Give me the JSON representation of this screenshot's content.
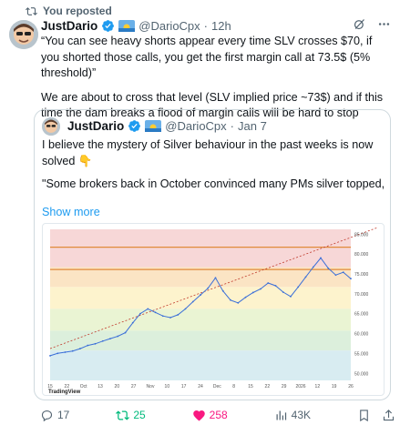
{
  "repost": {
    "label": "You reposted"
  },
  "tweet": {
    "author_name": "JustDario",
    "handle": "@DarioCpx",
    "dot": "·",
    "time": "12h",
    "paragraphs": [
      "“You can see heavy shorts appear every time SLV crosses $70, if you shorted those calls, you get the first margin call at 73.5$ (5% threshold)”",
      "We are about to cross that level (SLV implied price ~73$) and if this time the dam breaks a flood of margin calls will be hard to stop"
    ]
  },
  "quote": {
    "author_name": "JustDario",
    "handle": "@DarioCpx",
    "dot": "·",
    "time": "Jan 7",
    "paragraphs": [
      "I believe the mystery of Silver behaviour in the past weeks is now solved 👇",
      "\"Some brokers back in October convinced many PMs silver topped, the BCOM rebal came out end Oct, and those shorts increased because ..."
    ],
    "show_more": "Show more"
  },
  "chart_data": {
    "type": "line",
    "watermark": "TradingView",
    "xlabel": "",
    "ylabel": "",
    "y_ticks_right": [
      "85.000",
      "80.000",
      "75.000",
      "70.000",
      "65.000",
      "60.000",
      "55.000",
      "50.000"
    ],
    "x_ticks": [
      "15",
      "22",
      "Oct",
      "13",
      "20",
      "27",
      "Nov",
      "10",
      "17",
      "24",
      "Dec",
      "8",
      "15",
      "22",
      "29",
      "2026",
      "12",
      "19",
      "26"
    ],
    "x": [
      0,
      1,
      2,
      3,
      4,
      5,
      6,
      7,
      8,
      9,
      10,
      11,
      12,
      13,
      14,
      15,
      16,
      17,
      18,
      19,
      20,
      21,
      22,
      23,
      24,
      25,
      26,
      27,
      28,
      29,
      30,
      31,
      32,
      33,
      34,
      35,
      36,
      37,
      38,
      39,
      40
    ],
    "series": [
      {
        "values": [
          54.2,
          54.8,
          55.1,
          55.4,
          56.0,
          56.8,
          57.2,
          57.9,
          58.5,
          59.1,
          60.0,
          62.5,
          64.8,
          66.0,
          65.1,
          64.2,
          63.8,
          64.5,
          66.0,
          67.8,
          69.5,
          71.2,
          73.8,
          70.5,
          68.2,
          67.5,
          68.9,
          70.1,
          71.0,
          72.5,
          71.8,
          70.2,
          69.1,
          71.5,
          74.0,
          76.5,
          78.8,
          76.2,
          74.5,
          75.2,
          73.6
        ]
      }
    ],
    "bands": [
      {
        "from": 76.5,
        "to": 86.0,
        "color": "#f7d7d7"
      },
      {
        "from": 71.5,
        "to": 76.5,
        "color": "#fbe4c4"
      },
      {
        "from": 66.0,
        "to": 71.5,
        "color": "#fdf3cd"
      },
      {
        "from": 60.5,
        "to": 66.0,
        "color": "#eaf4d3"
      },
      {
        "from": 55.5,
        "to": 60.5,
        "color": "#dcefdc"
      },
      {
        "from": 48.0,
        "to": 55.5,
        "color": "#d8ecf1"
      }
    ],
    "hlines": [
      {
        "y": 81.5,
        "color": "#e08a3a"
      },
      {
        "y": 75.9,
        "color": "#e08a3a"
      }
    ],
    "ylim": [
      48,
      86
    ],
    "colors": {
      "line": "#3b6fd8",
      "trend": "#c0392b"
    }
  },
  "actions": {
    "replies": "17",
    "reposts": "25",
    "likes": "258",
    "views": "43K"
  },
  "colors": {
    "accent": "#1d9bf0",
    "repost_green": "#00ba7c",
    "like_pink": "#f91880"
  }
}
